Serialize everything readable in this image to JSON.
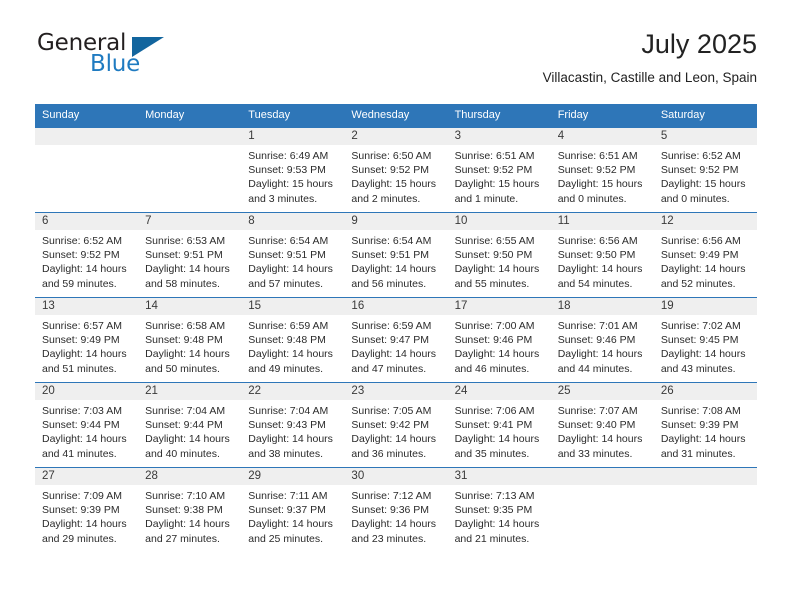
{
  "brand": {
    "name_part1": "General",
    "name_part2": "Blue",
    "triangle_color": "#12659e",
    "blue_color": "#1f7bc1"
  },
  "header": {
    "title": "July 2025",
    "subtitle": "Villacastin, Castille and Leon, Spain"
  },
  "theme": {
    "header_bg": "#2e76b8",
    "daynum_bg": "#efefef",
    "border": "#2e76b8",
    "text": "#2b2b2b"
  },
  "weekday_headers": [
    "Sunday",
    "Monday",
    "Tuesday",
    "Wednesday",
    "Thursday",
    "Friday",
    "Saturday"
  ],
  "weeks": [
    [
      {
        "day": "",
        "sunrise": "",
        "sunset": "",
        "daylight_line1": "",
        "daylight_line2": "",
        "empty": true
      },
      {
        "day": "",
        "sunrise": "",
        "sunset": "",
        "daylight_line1": "",
        "daylight_line2": "",
        "empty": true
      },
      {
        "day": "1",
        "sunrise": "Sunrise: 6:49 AM",
        "sunset": "Sunset: 9:53 PM",
        "daylight_line1": "Daylight: 15 hours",
        "daylight_line2": "and 3 minutes."
      },
      {
        "day": "2",
        "sunrise": "Sunrise: 6:50 AM",
        "sunset": "Sunset: 9:52 PM",
        "daylight_line1": "Daylight: 15 hours",
        "daylight_line2": "and 2 minutes."
      },
      {
        "day": "3",
        "sunrise": "Sunrise: 6:51 AM",
        "sunset": "Sunset: 9:52 PM",
        "daylight_line1": "Daylight: 15 hours",
        "daylight_line2": "and 1 minute."
      },
      {
        "day": "4",
        "sunrise": "Sunrise: 6:51 AM",
        "sunset": "Sunset: 9:52 PM",
        "daylight_line1": "Daylight: 15 hours",
        "daylight_line2": "and 0 minutes."
      },
      {
        "day": "5",
        "sunrise": "Sunrise: 6:52 AM",
        "sunset": "Sunset: 9:52 PM",
        "daylight_line1": "Daylight: 15 hours",
        "daylight_line2": "and 0 minutes."
      }
    ],
    [
      {
        "day": "6",
        "sunrise": "Sunrise: 6:52 AM",
        "sunset": "Sunset: 9:52 PM",
        "daylight_line1": "Daylight: 14 hours",
        "daylight_line2": "and 59 minutes."
      },
      {
        "day": "7",
        "sunrise": "Sunrise: 6:53 AM",
        "sunset": "Sunset: 9:51 PM",
        "daylight_line1": "Daylight: 14 hours",
        "daylight_line2": "and 58 minutes."
      },
      {
        "day": "8",
        "sunrise": "Sunrise: 6:54 AM",
        "sunset": "Sunset: 9:51 PM",
        "daylight_line1": "Daylight: 14 hours",
        "daylight_line2": "and 57 minutes."
      },
      {
        "day": "9",
        "sunrise": "Sunrise: 6:54 AM",
        "sunset": "Sunset: 9:51 PM",
        "daylight_line1": "Daylight: 14 hours",
        "daylight_line2": "and 56 minutes."
      },
      {
        "day": "10",
        "sunrise": "Sunrise: 6:55 AM",
        "sunset": "Sunset: 9:50 PM",
        "daylight_line1": "Daylight: 14 hours",
        "daylight_line2": "and 55 minutes."
      },
      {
        "day": "11",
        "sunrise": "Sunrise: 6:56 AM",
        "sunset": "Sunset: 9:50 PM",
        "daylight_line1": "Daylight: 14 hours",
        "daylight_line2": "and 54 minutes."
      },
      {
        "day": "12",
        "sunrise": "Sunrise: 6:56 AM",
        "sunset": "Sunset: 9:49 PM",
        "daylight_line1": "Daylight: 14 hours",
        "daylight_line2": "and 52 minutes."
      }
    ],
    [
      {
        "day": "13",
        "sunrise": "Sunrise: 6:57 AM",
        "sunset": "Sunset: 9:49 PM",
        "daylight_line1": "Daylight: 14 hours",
        "daylight_line2": "and 51 minutes."
      },
      {
        "day": "14",
        "sunrise": "Sunrise: 6:58 AM",
        "sunset": "Sunset: 9:48 PM",
        "daylight_line1": "Daylight: 14 hours",
        "daylight_line2": "and 50 minutes."
      },
      {
        "day": "15",
        "sunrise": "Sunrise: 6:59 AM",
        "sunset": "Sunset: 9:48 PM",
        "daylight_line1": "Daylight: 14 hours",
        "daylight_line2": "and 49 minutes."
      },
      {
        "day": "16",
        "sunrise": "Sunrise: 6:59 AM",
        "sunset": "Sunset: 9:47 PM",
        "daylight_line1": "Daylight: 14 hours",
        "daylight_line2": "and 47 minutes."
      },
      {
        "day": "17",
        "sunrise": "Sunrise: 7:00 AM",
        "sunset": "Sunset: 9:46 PM",
        "daylight_line1": "Daylight: 14 hours",
        "daylight_line2": "and 46 minutes."
      },
      {
        "day": "18",
        "sunrise": "Sunrise: 7:01 AM",
        "sunset": "Sunset: 9:46 PM",
        "daylight_line1": "Daylight: 14 hours",
        "daylight_line2": "and 44 minutes."
      },
      {
        "day": "19",
        "sunrise": "Sunrise: 7:02 AM",
        "sunset": "Sunset: 9:45 PM",
        "daylight_line1": "Daylight: 14 hours",
        "daylight_line2": "and 43 minutes."
      }
    ],
    [
      {
        "day": "20",
        "sunrise": "Sunrise: 7:03 AM",
        "sunset": "Sunset: 9:44 PM",
        "daylight_line1": "Daylight: 14 hours",
        "daylight_line2": "and 41 minutes."
      },
      {
        "day": "21",
        "sunrise": "Sunrise: 7:04 AM",
        "sunset": "Sunset: 9:44 PM",
        "daylight_line1": "Daylight: 14 hours",
        "daylight_line2": "and 40 minutes."
      },
      {
        "day": "22",
        "sunrise": "Sunrise: 7:04 AM",
        "sunset": "Sunset: 9:43 PM",
        "daylight_line1": "Daylight: 14 hours",
        "daylight_line2": "and 38 minutes."
      },
      {
        "day": "23",
        "sunrise": "Sunrise: 7:05 AM",
        "sunset": "Sunset: 9:42 PM",
        "daylight_line1": "Daylight: 14 hours",
        "daylight_line2": "and 36 minutes."
      },
      {
        "day": "24",
        "sunrise": "Sunrise: 7:06 AM",
        "sunset": "Sunset: 9:41 PM",
        "daylight_line1": "Daylight: 14 hours",
        "daylight_line2": "and 35 minutes."
      },
      {
        "day": "25",
        "sunrise": "Sunrise: 7:07 AM",
        "sunset": "Sunset: 9:40 PM",
        "daylight_line1": "Daylight: 14 hours",
        "daylight_line2": "and 33 minutes."
      },
      {
        "day": "26",
        "sunrise": "Sunrise: 7:08 AM",
        "sunset": "Sunset: 9:39 PM",
        "daylight_line1": "Daylight: 14 hours",
        "daylight_line2": "and 31 minutes."
      }
    ],
    [
      {
        "day": "27",
        "sunrise": "Sunrise: 7:09 AM",
        "sunset": "Sunset: 9:39 PM",
        "daylight_line1": "Daylight: 14 hours",
        "daylight_line2": "and 29 minutes."
      },
      {
        "day": "28",
        "sunrise": "Sunrise: 7:10 AM",
        "sunset": "Sunset: 9:38 PM",
        "daylight_line1": "Daylight: 14 hours",
        "daylight_line2": "and 27 minutes."
      },
      {
        "day": "29",
        "sunrise": "Sunrise: 7:11 AM",
        "sunset": "Sunset: 9:37 PM",
        "daylight_line1": "Daylight: 14 hours",
        "daylight_line2": "and 25 minutes."
      },
      {
        "day": "30",
        "sunrise": "Sunrise: 7:12 AM",
        "sunset": "Sunset: 9:36 PM",
        "daylight_line1": "Daylight: 14 hours",
        "daylight_line2": "and 23 minutes."
      },
      {
        "day": "31",
        "sunrise": "Sunrise: 7:13 AM",
        "sunset": "Sunset: 9:35 PM",
        "daylight_line1": "Daylight: 14 hours",
        "daylight_line2": "and 21 minutes."
      },
      {
        "day": "",
        "sunrise": "",
        "sunset": "",
        "daylight_line1": "",
        "daylight_line2": "",
        "empty": true
      },
      {
        "day": "",
        "sunrise": "",
        "sunset": "",
        "daylight_line1": "",
        "daylight_line2": "",
        "empty": true
      }
    ]
  ]
}
